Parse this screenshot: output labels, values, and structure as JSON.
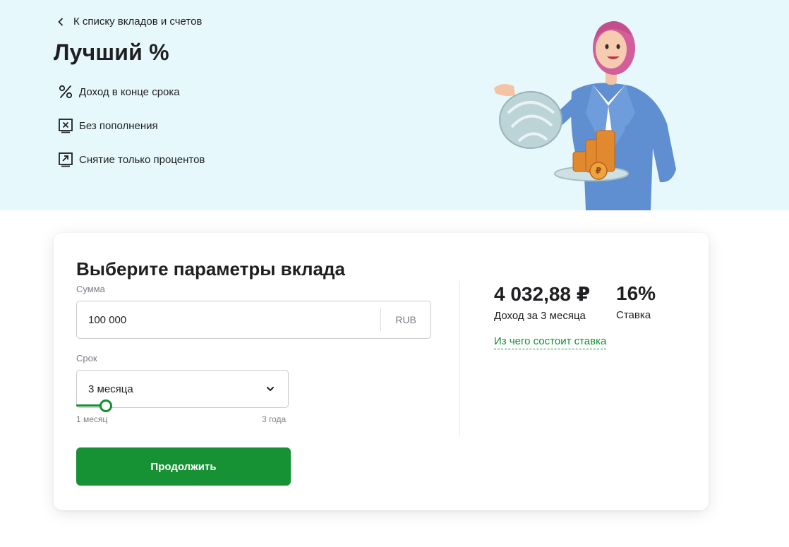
{
  "header": {
    "back_link": "К списку вкладов и счетов",
    "title": "Лучший %",
    "features": [
      {
        "icon": "percent-icon",
        "label": "Доход в конце срока"
      },
      {
        "icon": "no-topup-icon",
        "label": "Без пополнения"
      },
      {
        "icon": "withdraw-interest-icon",
        "label": "Снятие только процентов"
      }
    ]
  },
  "form": {
    "title": "Выберите параметры вклада",
    "sum_label": "Сумма",
    "sum_value": "100 000",
    "currency": "RUB",
    "term_label": "Срок",
    "term_value": "3 месяца",
    "slider_min": "1 месяц",
    "slider_max": "3 года",
    "slider_fraction": 0.14,
    "continue_label": "Продолжить"
  },
  "result": {
    "income_value": "4 032,88 ₽",
    "income_label": "Доход за 3 месяца",
    "rate_value": "16%",
    "rate_label": "Ставка",
    "rate_link": "Из чего состоит ставка"
  },
  "colors": {
    "accent": "#128f33",
    "button": "#169133",
    "hero_bg": "#e6f8fb"
  }
}
